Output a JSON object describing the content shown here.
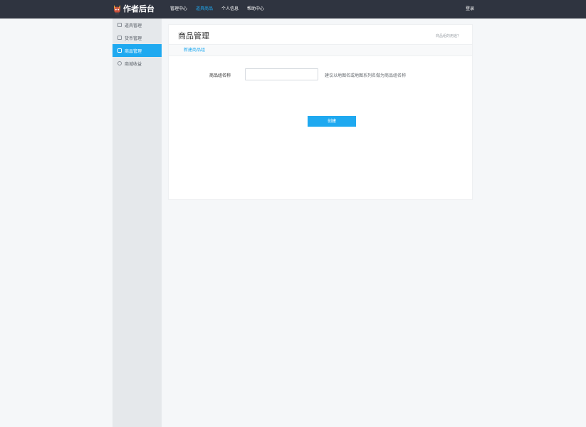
{
  "brand": {
    "name": "作者后台",
    "logo_icon": "mascot-logo-icon"
  },
  "nav": {
    "items": [
      {
        "label": "管理中心",
        "active": false
      },
      {
        "label": "道具商品",
        "active": true
      },
      {
        "label": "个人信息",
        "active": false
      },
      {
        "label": "帮助中心",
        "active": false
      }
    ],
    "login_label": "登录"
  },
  "sidebar": {
    "items": [
      {
        "label": "道具管理",
        "icon": "item-box-icon",
        "active": false
      },
      {
        "label": "货币管理",
        "icon": "currency-icon",
        "active": false
      },
      {
        "label": "商品管理",
        "icon": "document-icon",
        "active": true
      },
      {
        "label": "商城收益",
        "icon": "revenue-icon",
        "active": false
      }
    ]
  },
  "main": {
    "title": "商品管理",
    "help_link": "商品组的用途？",
    "tab": "新建商品组",
    "form": {
      "name_label": "商品组名称",
      "name_value": "",
      "name_placeholder": "",
      "hint": "建议以地图名或地图系列名做为商品组名称",
      "submit_label": "创建"
    }
  },
  "colors": {
    "topbar": "#2f3440",
    "accent": "#1fa9f0",
    "sidebar": "#e5e8eb",
    "page_bg": "#f5f7f9"
  }
}
